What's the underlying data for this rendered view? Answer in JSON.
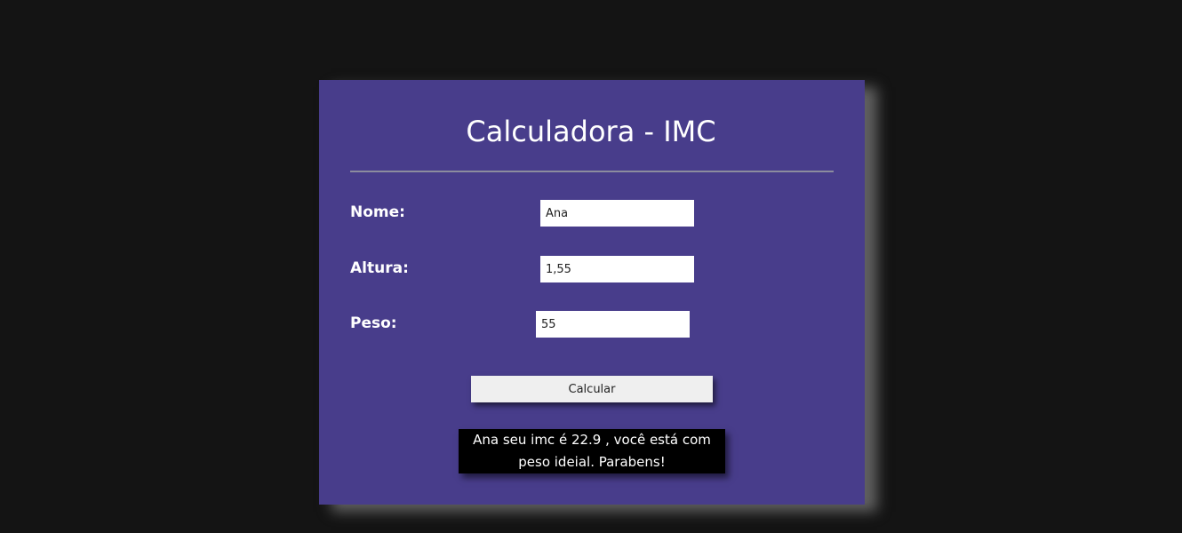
{
  "header": {
    "title": "Calculadora - IMC"
  },
  "form": {
    "nome_label": "Nome:",
    "nome_value": "Ana",
    "altura_label": "Altura:",
    "altura_value": "1,55",
    "peso_label": "Peso:",
    "peso_value": "55"
  },
  "actions": {
    "calcular_label": "Calcular"
  },
  "result": {
    "message": "Ana seu imc é 22.9 , você está com peso ideial. Parabens!"
  },
  "colors": {
    "page_background": "#141414",
    "card_background": "#483d8b",
    "result_background": "#000000",
    "button_background": "#efefef"
  }
}
